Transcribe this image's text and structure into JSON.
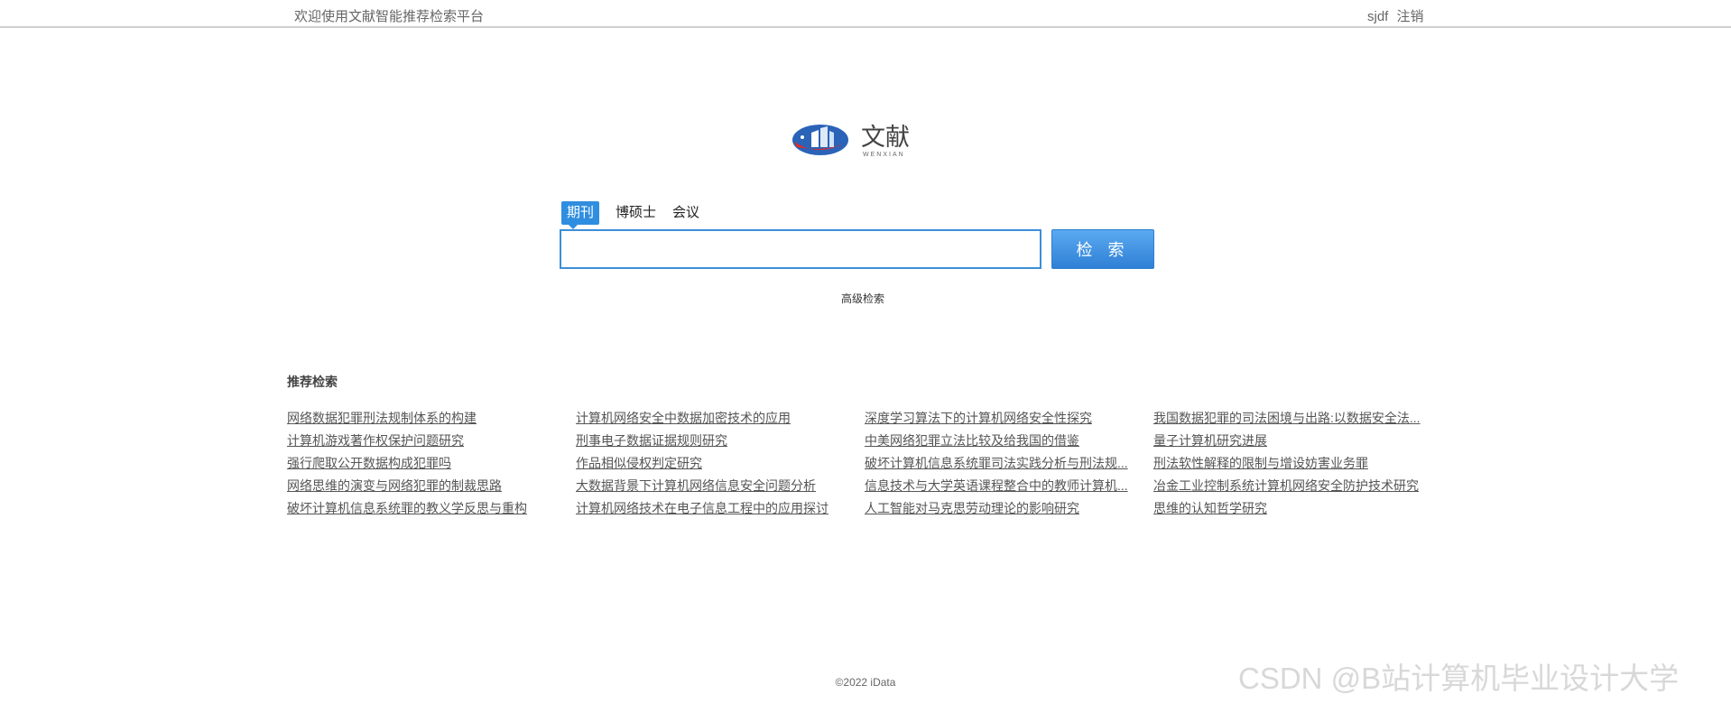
{
  "header": {
    "welcome": "欢迎使用文献智能推荐检索平台",
    "username": "sjdf",
    "logout": "注销"
  },
  "logo": {
    "text": "文献",
    "subtext": "WENXIAN",
    "colors": {
      "blue": "#2a63b8",
      "red": "#d92d2d",
      "dark": "#444444"
    }
  },
  "search": {
    "tabs": [
      {
        "label": "期刊",
        "active": true
      },
      {
        "label": "博硕士",
        "active": false
      },
      {
        "label": "会议",
        "active": false
      }
    ],
    "input_value": "",
    "button_label": "检 索",
    "advanced_label": "高级检索"
  },
  "recommend": {
    "title": "推荐检索",
    "columns": [
      [
        "网络数据犯罪刑法规制体系的构建",
        "计算机游戏著作权保护问题研究",
        "强行爬取公开数据构成犯罪吗",
        "网络思维的演变与网络犯罪的制裁思路",
        "破坏计算机信息系统罪的教义学反思与重构"
      ],
      [
        "计算机网络安全中数据加密技术的应用",
        "刑事电子数据证据规则研究",
        "作品相似侵权判定研究",
        "大数据背景下计算机网络信息安全问题分析",
        "计算机网络技术在电子信息工程中的应用探讨"
      ],
      [
        "深度学习算法下的计算机网络安全性探究",
        "中美网络犯罪立法比较及给我国的借鉴",
        "破坏计算机信息系统罪司法实践分析与刑法规...",
        "信息技术与大学英语课程整合中的教师计算机...",
        "人工智能对马克思劳动理论的影响研究"
      ],
      [
        "我国数据犯罪的司法困境与出路:以数据安全法...",
        "量子计算机研究进展",
        "刑法软性解释的限制与增设妨害业务罪",
        "冶金工业控制系统计算机网络安全防护技术研究",
        "思维的认知哲学研究"
      ]
    ]
  },
  "footer": {
    "copyright": "©2022 iData"
  },
  "watermark": "CSDN @B站计算机毕业设计大学"
}
